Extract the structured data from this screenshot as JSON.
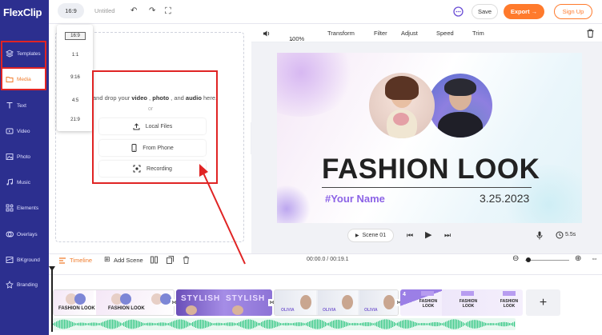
{
  "app": {
    "logo": "FlexClip",
    "title": "Untitled",
    "ratio": "16:9"
  },
  "toolbar": {
    "save": "Save",
    "export": "Export →",
    "signup": "Sign Up"
  },
  "sidebar": {
    "items": [
      {
        "label": "Templates",
        "icon": "layers-icon"
      },
      {
        "label": "Media",
        "icon": "folder-icon"
      },
      {
        "label": "Text",
        "icon": "text-icon"
      },
      {
        "label": "Video",
        "icon": "video-icon"
      },
      {
        "label": "Photo",
        "icon": "photo-icon"
      },
      {
        "label": "Music",
        "icon": "music-icon"
      },
      {
        "label": "Elements",
        "icon": "shapes-icon"
      },
      {
        "label": "Overlays",
        "icon": "overlay-icon"
      },
      {
        "label": "BKground",
        "icon": "background-icon"
      },
      {
        "label": "Branding",
        "icon": "branding-icon"
      }
    ]
  },
  "ratio_menu": {
    "options": [
      "16:9",
      "1:1",
      "9:16",
      "4:5",
      "21:9"
    ],
    "selected": "16:9"
  },
  "upload": {
    "prefix": "and drop your ",
    "video": "video",
    "sep1": " , ",
    "photo": "photo",
    "sep2": " , and ",
    "audio": "audio",
    "suffix": " here.",
    "or": "or",
    "local_files": "Local Files",
    "from_phone": "From Phone",
    "recording": "Recording"
  },
  "editbar": {
    "zoom": "100%",
    "transform": "Transform",
    "filter": "Filter",
    "adjust": "Adjust",
    "speed": "Speed",
    "trim": "Trim"
  },
  "slide": {
    "title": "FASHION LOOK",
    "name": "#Your Name",
    "date": "3.25.2023"
  },
  "player": {
    "scene": "Scene 01",
    "duration": "5.5s"
  },
  "timeline": {
    "label": "Timeline",
    "add_scene": "Add Scene",
    "time": "00:00.0 / 00:19.1"
  },
  "clips": [
    {
      "text": "FASHION LOOK"
    },
    {
      "text": "STYLISH"
    },
    {
      "text": "OLIVIA"
    },
    {
      "text": "FASHION LOOK"
    }
  ],
  "colors": {
    "sidebar": "#2c2f8f",
    "accent": "#ff7a2c",
    "highlight": "#e02424",
    "purple": "#8c63e6"
  }
}
